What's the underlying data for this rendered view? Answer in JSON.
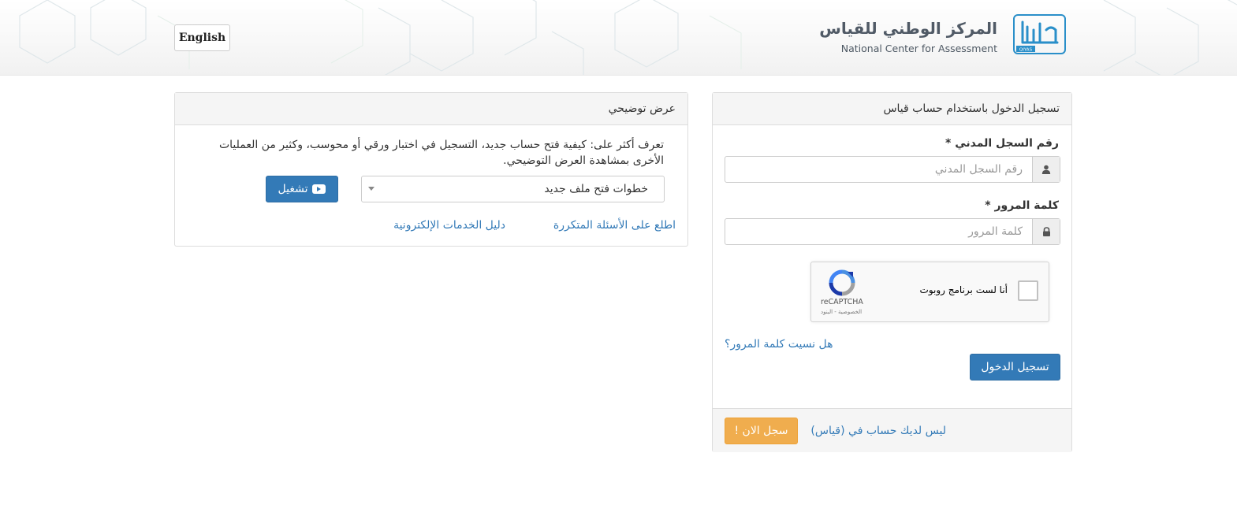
{
  "header": {
    "language_button": "English",
    "logo_arabic": "المركز الوطني للقياس",
    "logo_english": "National Center for Assessment",
    "logo_mark_text": "QIYAS"
  },
  "login": {
    "title": "تسجيل الدخول باستخدام حساب قياس",
    "id_label": "رقم السجل المدني *",
    "id_placeholder": "رقم السجل المدني",
    "password_label": "كلمة المرور *",
    "password_placeholder": "كلمة المرور",
    "captcha": {
      "text": "أنا لست برنامج روبوت",
      "brand": "reCAPTCHA",
      "terms": "الخصوصية - البنود"
    },
    "forgot_link": "هل نسيت كلمة المرور؟",
    "submit": "تسجيل الدخول",
    "no_account_text": "ليس لديك حساب في (قياس)",
    "register_button": "سجل الان !"
  },
  "demo": {
    "title": "عرض توضيحي",
    "description": "تعرف أكثر على: كيفية فتح حساب جديد، التسجيل في اختبار ورقي أو محوسب، وكثير من العمليات الأخرى بمشاهدة العرض التوضيحي.",
    "select_value": "خطوات فتح ملف جديد",
    "play_button": "تشغيل",
    "faq_link": "اطلع على الأسئلة المتكررة",
    "guide_link": "دليل الخدمات الإلكترونية"
  },
  "colors": {
    "primary": "#337ab7",
    "warning": "#f0ad4e",
    "logo_blue": "#2a8fc9"
  }
}
